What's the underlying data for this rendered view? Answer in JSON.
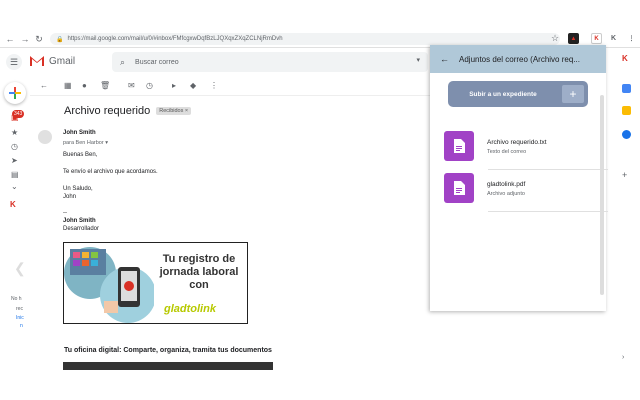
{
  "browser": {
    "url": "https://mail.google.com/mail/u/0/#inbox/FMfcgxwDqfBzLJQXqxZXqZCLNjRmDvh",
    "back_icon": "arrow-left-icon",
    "forward_icon": "arrow-right-icon",
    "reload_icon": "reload-icon"
  },
  "gmail": {
    "app_name": "Gmail",
    "search_placeholder": "Buscar correo",
    "unread_count": "343"
  },
  "message": {
    "subject": "Archivo requerido",
    "label": "Recibidos",
    "label_close": "×",
    "sender": "John Smith",
    "to_line": "para Ben Harbor",
    "to_caret": "▾",
    "greeting": "Buenas Ben,",
    "body": "Te envío el archivo que acordamos.",
    "signoff": "Un Saludo,",
    "signoff_name": "John",
    "sig_sep": "--",
    "sig_name": "John Smith",
    "sig_role": "Desarrollador",
    "banner_text": "Tu registro de jornada laboral con",
    "banner_brand": "gladtolink",
    "footer_title": "Tu oficina digital: Comparte, organiza, tramita tus documentos"
  },
  "left_rail_text": {
    "line1": "No h",
    "line2": "rec",
    "line3": "Inic",
    "line4": "n"
  },
  "panel": {
    "title": "Adjuntos del correo (Archivo req...",
    "upload_label": "Subir a un expediente",
    "attachments": [
      {
        "name": "Archivo requerido.txt",
        "sub": "Texto del correo"
      },
      {
        "name": "gladtolink.pdf",
        "sub": "Archivo adjunto"
      }
    ]
  },
  "colors": {
    "panel_header": "#b0c8d8",
    "upload_button": "#7e8fad",
    "file_icon": "#a142c6",
    "badge": "#d93025"
  }
}
